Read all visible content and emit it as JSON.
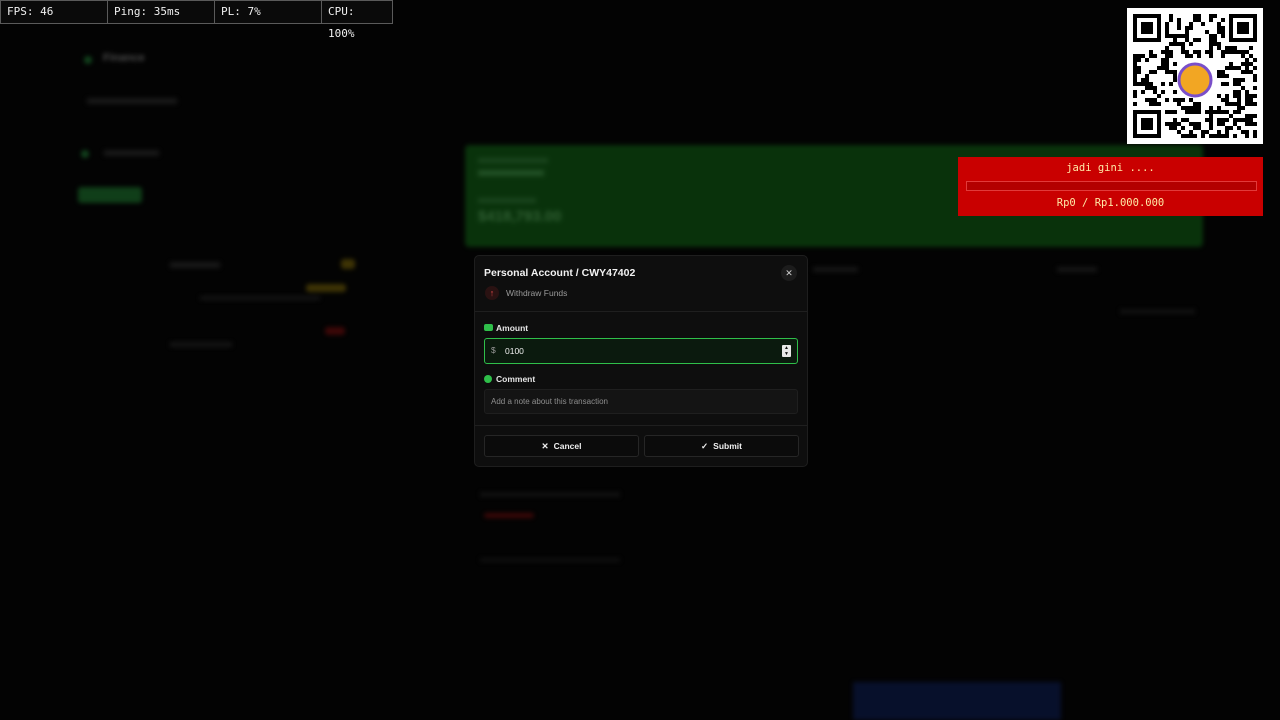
{
  "stats": {
    "fps": "FPS: 46",
    "ping": "Ping: 35ms",
    "pl": "PL: 7%",
    "cpu": "CPU: 100%"
  },
  "background": {
    "app_name": "Finance",
    "hero_amount": "$418,793.00"
  },
  "modal": {
    "title": "Personal Account / CWY47402",
    "action": "Withdraw Funds",
    "amount_label": "Amount",
    "amount_prefix": "$",
    "amount_value": "0100",
    "comment_label": "Comment",
    "comment_placeholder": "Add a note about this transaction",
    "cancel_label": "Cancel",
    "submit_label": "Submit",
    "close_glyph": "✕",
    "cancel_glyph": "✕",
    "submit_glyph": "✓",
    "action_glyph": "↑"
  },
  "donation": {
    "message": "jadi gini ....",
    "progress": 0,
    "amount": "Rp0 / Rp1.000.000"
  },
  "icons": {
    "amount": "money-icon",
    "comment": "chat-bubble-icon",
    "action": "arrow-up-icon",
    "close": "close-icon",
    "qr": "qr-code-icon"
  },
  "colors": {
    "accent": "#2fbf4a",
    "danger": "#e24b4b",
    "donation_bg": "#c90000",
    "donation_text": "#ffe9a6"
  }
}
